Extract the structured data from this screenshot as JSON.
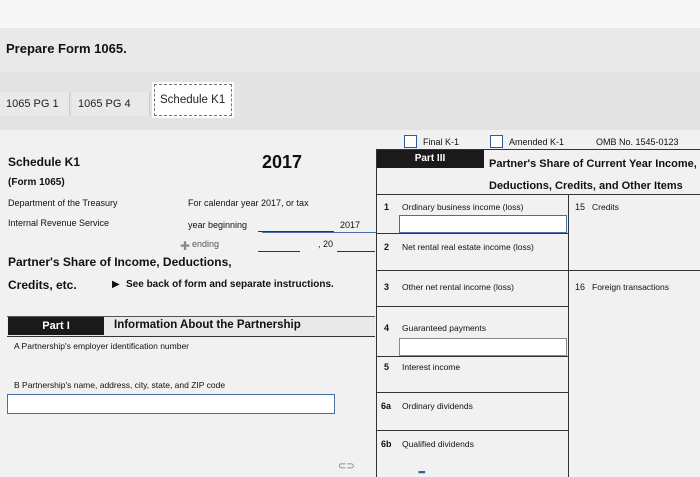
{
  "header": {
    "title": "Prepare Form 1065."
  },
  "tabs": [
    {
      "label": "1065 PG 1"
    },
    {
      "label": "1065 PG 4"
    },
    {
      "label": "Schedule K1"
    }
  ],
  "form_left": {
    "schedule": "Schedule K1",
    "form": "(Form 1065)",
    "dept": "Department of the Treasury",
    "irs": "Internal Revenue Service",
    "year": "2017",
    "calendar": "For calendar year 2017, or tax",
    "year_beginning": "year beginning",
    "year_small": "2017",
    "ending": "ending",
    "ending_year": ", 20",
    "title_line1": "Partner's Share of Income, Deductions,",
    "title_line2": "Credits, etc.",
    "see_back": "See back of form and separate instructions.",
    "part1_badge": "Part I",
    "part1_title": "Information About the Partnership",
    "lineA": "A  Partnership's employer identification number",
    "lineB": "B  Partnership's name, address, city, state, and ZIP code"
  },
  "form_right": {
    "final_k1": "Final K-1",
    "amended_k1": "Amended K-1",
    "omb": "OMB No. 1545-0123",
    "part3_badge": "Part III",
    "part3_title1": "Partner's Share of Current Year Income,",
    "part3_title2": "Deductions, Credits, and Other Items",
    "rows": [
      {
        "num": "1",
        "label": "Ordinary business income (loss)"
      },
      {
        "num": "2",
        "label": "Net rental real estate income (loss)"
      },
      {
        "num": "3",
        "label": "Other net rental income (loss)"
      },
      {
        "num": "4",
        "label": "Guaranteed payments"
      },
      {
        "num": "5",
        "label": "Interest income"
      },
      {
        "num": "6a",
        "label": "Ordinary dividends"
      },
      {
        "num": "6b",
        "label": "Qualified dividends"
      }
    ],
    "box15": {
      "num": "15",
      "label": "Credits"
    },
    "box16": {
      "num": "16",
      "label": "Foreign transactions"
    }
  }
}
